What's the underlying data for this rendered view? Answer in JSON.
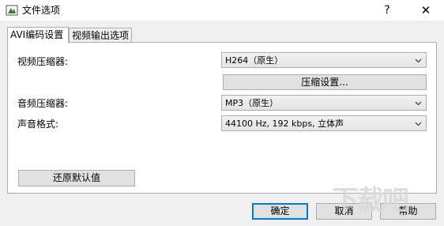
{
  "window": {
    "title": "文件选项",
    "help_label": "?",
    "close_label": "✕"
  },
  "tabs": [
    {
      "label": "AVI编码设置"
    },
    {
      "label": "视频输出选项"
    }
  ],
  "video": {
    "compressor_label": "视频压缩器:",
    "compressor_value": "H264（原生）",
    "settings_button": "压缩设置..."
  },
  "audio": {
    "compressor_label": "音频压缩器:",
    "compressor_value": "MP3（原生）",
    "format_label": "声音格式:",
    "format_value": "44100 Hz, 192 kbps, 立体声"
  },
  "buttons": {
    "restore": "还原默认值",
    "ok": "确定",
    "cancel": "取消",
    "help": "帮助"
  },
  "colors": {
    "default_button_border": "#0078d7",
    "panel_background": "#ffffff",
    "dialog_background": "#f0f0f0"
  },
  "watermark": "下载吧"
}
